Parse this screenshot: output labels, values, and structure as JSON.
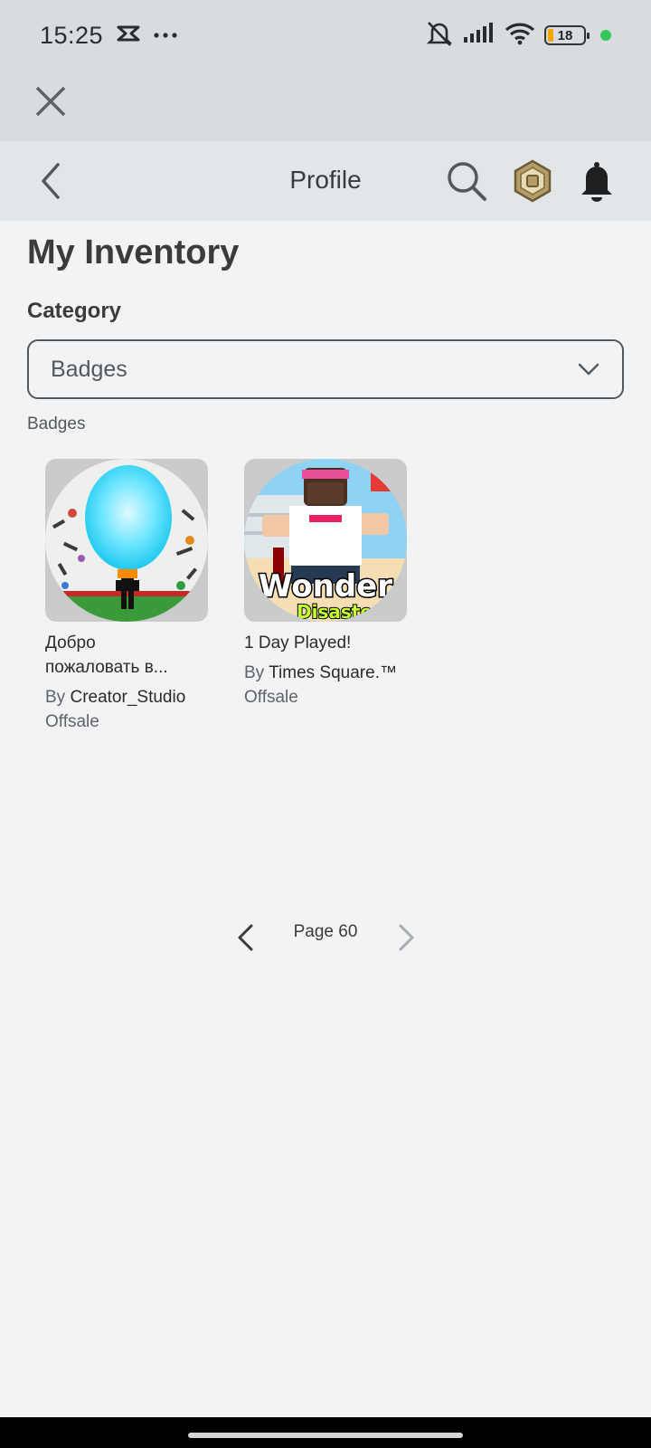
{
  "status_bar": {
    "time": "15:25",
    "battery": "18",
    "icons": [
      "capcut-icon",
      "more-dots-icon",
      "mute-bell-icon",
      "signal-icon",
      "wifi-icon",
      "battery-icon",
      "privacy-dot-icon"
    ]
  },
  "header": {
    "title": "Profile"
  },
  "page": {
    "heading": "My Inventory",
    "category_label": "Category",
    "category_value": "Badges",
    "section_label": "Badges"
  },
  "items": [
    {
      "name": "Добро\nпожаловать в...",
      "by": "By",
      "creator": "Creator_Studio",
      "price": "Offsale"
    },
    {
      "name": "1 Day Played!",
      "by": "By",
      "creator": "Times Square.™",
      "price": "Offsale"
    }
  ],
  "pagination": {
    "label": "Page 60"
  },
  "colors": {
    "status_bg": "#d9dcdf",
    "header_bg": "#e3e6e9",
    "page_bg": "#f2f3f5",
    "text": "#393b3d",
    "robux_gold": "#b59e6a",
    "privacy_dot": "#34c759"
  }
}
